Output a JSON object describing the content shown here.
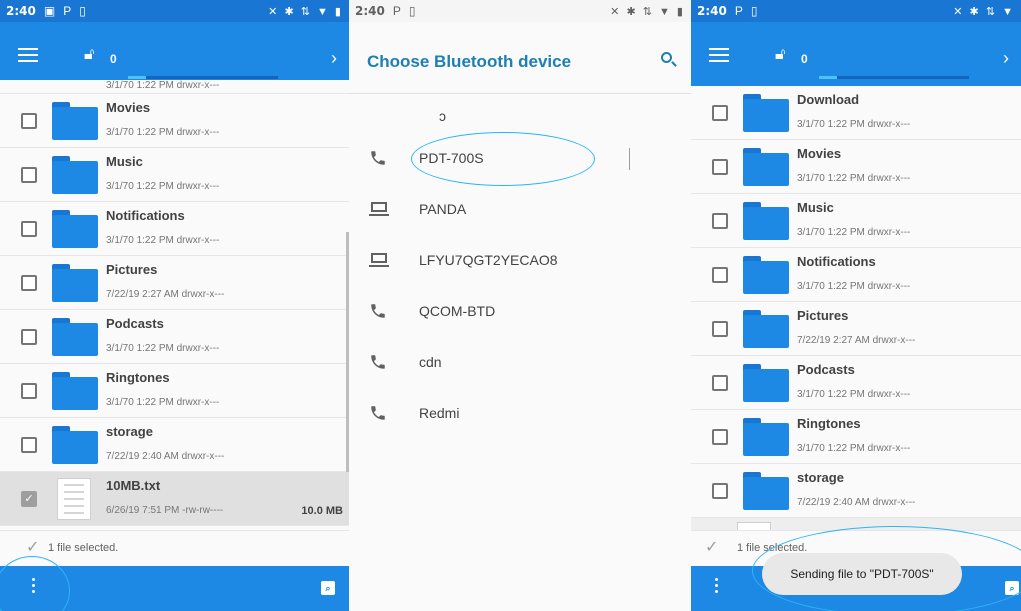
{
  "status": {
    "time": "2:40"
  },
  "left": {
    "appbar": {
      "count": "0",
      "progress": 0.12
    },
    "partial_meta": "3/1/70 1:22 PM  drwxr-x---",
    "rows": [
      {
        "name": "Movies",
        "meta": "3/1/70 1:22 PM  drwxr-x---"
      },
      {
        "name": "Music",
        "meta": "3/1/70 1:22 PM  drwxr-x---"
      },
      {
        "name": "Notifications",
        "meta": "3/1/70 1:22 PM  drwxr-x---"
      },
      {
        "name": "Pictures",
        "meta": "7/22/19 2:27 AM  drwxr-x---"
      },
      {
        "name": "Podcasts",
        "meta": "3/1/70 1:22 PM  drwxr-x---"
      },
      {
        "name": "Ringtones",
        "meta": "3/1/70 1:22 PM  drwxr-x---"
      },
      {
        "name": "storage",
        "meta": "7/22/19 2:40 AM  drwxr-x---"
      }
    ],
    "file": {
      "name": "10MB.txt",
      "meta": "6/26/19 7:51 PM  -rw-rw----",
      "size": "10.0 MB"
    },
    "selection": "1 file selected."
  },
  "middle": {
    "title": "Choose Bluetooth device",
    "devices": [
      {
        "label": "PDT-700S",
        "icon": "phone-icon"
      },
      {
        "label": "PANDA",
        "icon": "laptop-icon"
      },
      {
        "label": "LFYU7QGT2YECAO8",
        "icon": "laptop-icon"
      },
      {
        "label": "QCOM-BTD",
        "icon": "phone-icon"
      },
      {
        "label": "cdn",
        "icon": "phone-icon"
      },
      {
        "label": "Redmi",
        "icon": "phone-icon"
      }
    ]
  },
  "right": {
    "appbar": {
      "count": "0",
      "progress": 0.12
    },
    "rows": [
      {
        "name": "Download",
        "meta": "3/1/70 1:22 PM  drwxr-x---"
      },
      {
        "name": "Movies",
        "meta": "3/1/70 1:22 PM  drwxr-x---"
      },
      {
        "name": "Music",
        "meta": "3/1/70 1:22 PM  drwxr-x---"
      },
      {
        "name": "Notifications",
        "meta": "3/1/70 1:22 PM  drwxr-x---"
      },
      {
        "name": "Pictures",
        "meta": "7/22/19 2:27 AM  drwxr-x---"
      },
      {
        "name": "Podcasts",
        "meta": "3/1/70 1:22 PM  drwxr-x---"
      },
      {
        "name": "Ringtones",
        "meta": "3/1/70 1:22 PM  drwxr-x---"
      },
      {
        "name": "storage",
        "meta": "7/22/19 2:40 AM  drwxr-x---"
      }
    ],
    "selection": "1 file selected.",
    "toast": "Sending file to \"PDT-700S\""
  },
  "colors": {
    "accent": "#1e88e5",
    "status": "#1976d2",
    "title": "#1e7fb3",
    "annotation": "#29b6f6"
  }
}
